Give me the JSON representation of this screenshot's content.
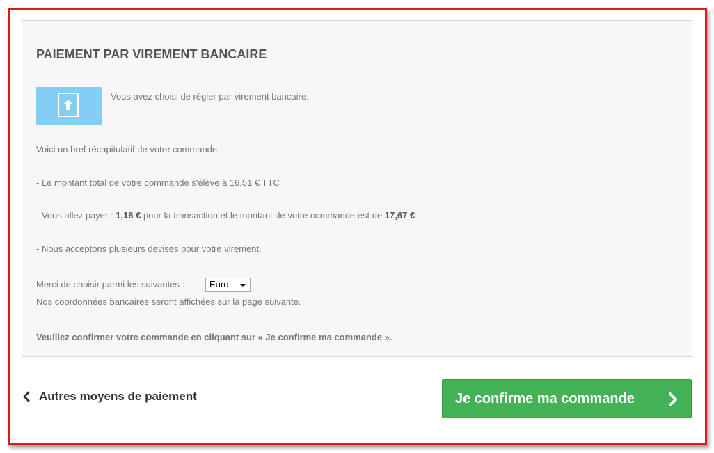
{
  "heading": "PAIEMENT PAR VIREMENT BANCAIRE",
  "intro": "Vous avez choisi de régler par virement bancaire.",
  "summary_intro": "Voici un bref récapitulatif de votre commande :",
  "total_line": "- Le montant total de votre commande s'élève à 16,51 € TTC",
  "payment_line": {
    "prefix": "- Vous allez payer : ",
    "fee": "1,16 €",
    "middle": " pour la transaction et le montant de votre commande est de ",
    "total": "17,67 €"
  },
  "currencies_line": "- Nous acceptons plusieurs devises pour votre virement.",
  "currency_choice": {
    "label": "Merci de choisir parmi les suivantes :",
    "selected": "Euro"
  },
  "bank_note": "Nos coordonnées bancaires seront affichées sur la page suivante.",
  "confirm_note": "Veuillez confirmer votre commande en cliquant sur « Je confirme ma commande ».",
  "back_link_label": "Autres moyens de paiement",
  "confirm_button_label": "Je confirme ma commande",
  "icons": {
    "tile": "upload-arrow-icon",
    "back": "chevron-left-icon",
    "confirm": "chevron-right-icon"
  },
  "colors": {
    "frame_border": "#e4141b",
    "tile": "#85cdf3",
    "button": "#43b155"
  }
}
